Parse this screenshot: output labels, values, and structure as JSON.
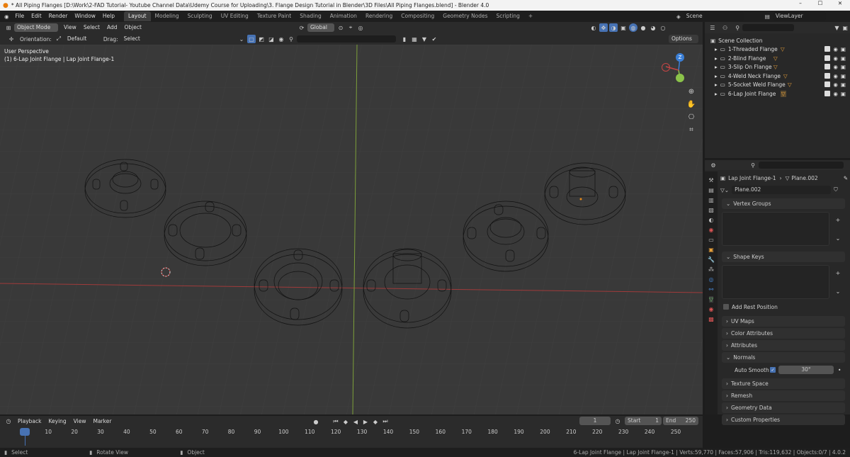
{
  "titlebar": {
    "title": "* All Piping Flanges [D:\\Work\\2-FAD Tutorial- Youtube Channel Data\\Udemy Course for Uploading\\3. Flange Design Tutorial in Blender\\3D Files\\All Piping Flanges.blend] - Blender 4.0"
  },
  "menu": {
    "items": [
      "File",
      "Edit",
      "Render",
      "Window",
      "Help"
    ]
  },
  "workspaces": [
    "Layout",
    "Modeling",
    "Sculpting",
    "UV Editing",
    "Texture Paint",
    "Shading",
    "Animation",
    "Rendering",
    "Compositing",
    "Geometry Nodes",
    "Scripting"
  ],
  "scene": {
    "name": "Scene",
    "view_layer": "ViewLayer"
  },
  "viewport_header": {
    "mode": "Object Mode",
    "view": "View",
    "select": "Select",
    "add": "Add",
    "object": "Object",
    "transform": "Global",
    "options": "Options"
  },
  "toolbar": {
    "orientation_label": "Orientation:",
    "orientation_value": "Default",
    "drag_label": "Drag:",
    "drag_value": "Select Box"
  },
  "viewport": {
    "perspective": "User Perspective",
    "object_info": "(1) 6-Lap Joint Flange | Lap Joint Flange-1"
  },
  "gizmo": {
    "z": "Z"
  },
  "outliner": {
    "root": "Scene Collection",
    "items": [
      "1-Threaded Flange",
      "2-Blind Flange",
      "3-Slip On Flange",
      "4-Weld Neck Flange",
      "5-Socket Weld Flange",
      "6-Lap Joint Flange"
    ]
  },
  "properties": {
    "breadcrumb_object": "Lap Joint Flange-1",
    "breadcrumb_mesh": "Plane.002",
    "mesh_name": "Plane.002",
    "panels": {
      "vertex_groups": "Vertex Groups",
      "shape_keys": "Shape Keys",
      "add_rest_position": "Add Rest Position",
      "uv_maps": "UV Maps",
      "color_attributes": "Color Attributes",
      "attributes": "Attributes",
      "normals": "Normals",
      "auto_smooth": "Auto Smooth",
      "auto_smooth_angle": "30°",
      "texture_space": "Texture Space",
      "remesh": "Remesh",
      "geometry_data": "Geometry Data",
      "custom_properties": "Custom Properties"
    }
  },
  "timeline": {
    "playback": "Playback",
    "keying": "Keying",
    "view": "View",
    "marker": "Marker",
    "current_frame": "1",
    "start_label": "Start",
    "start": "1",
    "end_label": "End",
    "end": "250",
    "ticks": [
      "1",
      "10",
      "20",
      "30",
      "40",
      "50",
      "60",
      "70",
      "80",
      "90",
      "100",
      "110",
      "120",
      "130",
      "140",
      "150",
      "160",
      "170",
      "180",
      "190",
      "200",
      "210",
      "220",
      "230",
      "240",
      "250"
    ]
  },
  "statusbar": {
    "select": "Select",
    "rotate": "Rotate View",
    "object": "Object",
    "info": "6-Lap Joint Flange | Lap Joint Flange-1 | Verts:59,770 | Faces:57,906 | Tris:119,632 | Objects:0/7 | 4.0.2"
  },
  "colors": {
    "accent": "#4772b3",
    "x_axis": "#c54545",
    "y_axis": "#8bc34a",
    "z_axis": "#3b7fd6",
    "viewport_bg": "#393939"
  }
}
